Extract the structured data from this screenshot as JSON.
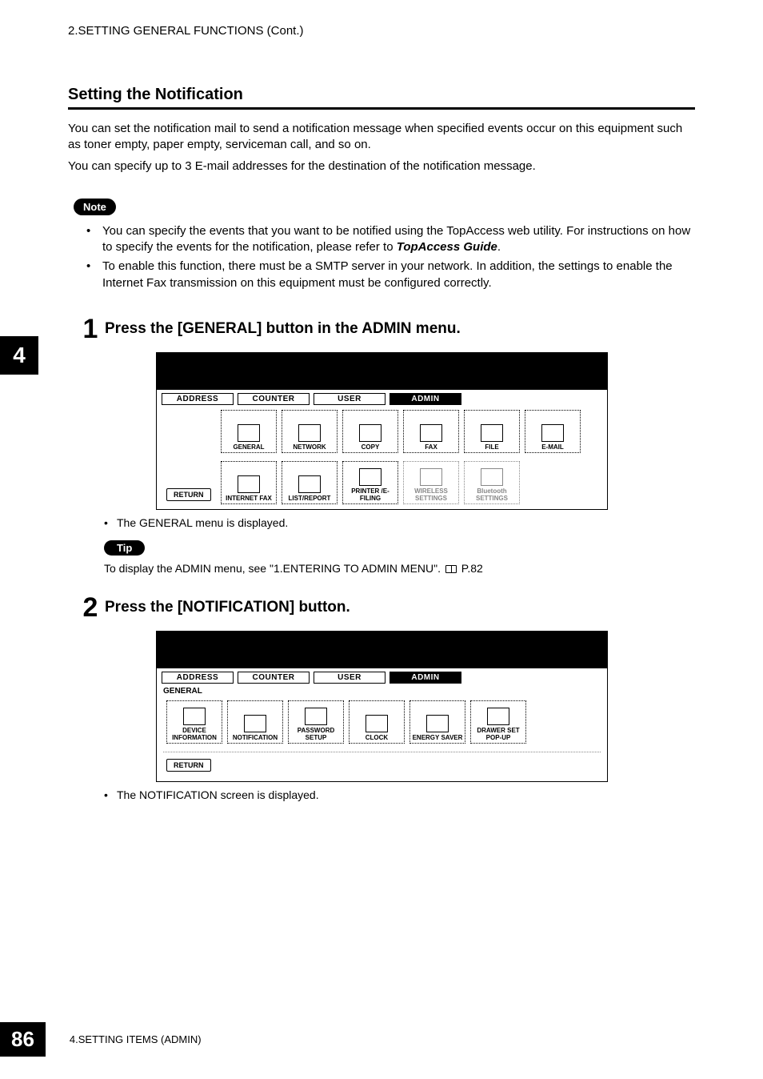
{
  "header": "2.SETTING GENERAL FUNCTIONS (Cont.)",
  "section_title": "Setting the Notification",
  "intro_p1": "You can set the notification mail to send a notification message when specified events occur on this equipment such as toner empty, paper empty, serviceman call, and so on.",
  "intro_p2": "You can specify up to 3 E-mail addresses for the destination of the notification message.",
  "note_label": "Note",
  "note_items": {
    "a_pre": "You can specify the events that you want to be notified using the TopAccess web utility.  For instructions on how to specify the events for the notification, please refer to ",
    "a_em": "TopAccess Guide",
    "a_post": ".",
    "b": "To enable this function, there must be a SMTP server in your network.  In addition, the settings to enable the Internet Fax transmission on this equipment must be configured correctly."
  },
  "side_tab": "4",
  "steps": {
    "s1": {
      "num": "1",
      "title": "Press the [GENERAL] button in the ADMIN menu.",
      "sub": "The GENERAL menu is displayed."
    },
    "s2": {
      "num": "2",
      "title": "Press the [NOTIFICATION] button.",
      "sub": "The NOTIFICATION screen is displayed."
    }
  },
  "tip_label": "Tip",
  "tip_text_pre": "To display the ADMIN menu, see \"1.ENTERING TO ADMIN MENU\".  ",
  "tip_text_ref": " P.82",
  "screen1": {
    "tabs": [
      "ADDRESS",
      "COUNTER",
      "USER",
      "ADMIN"
    ],
    "active_tab_index": 3,
    "row1": [
      "GENERAL",
      "NETWORK",
      "COPY",
      "FAX",
      "FILE",
      "E-MAIL"
    ],
    "row2": [
      "INTERNET FAX",
      "LIST/REPORT",
      "PRINTER /E-FILING",
      "WIRELESS SETTINGS",
      "Bluetooth SETTINGS"
    ],
    "return": "RETURN"
  },
  "screen2": {
    "tabs": [
      "ADDRESS",
      "COUNTER",
      "USER",
      "ADMIN"
    ],
    "active_tab_index": 3,
    "breadcrumb": "GENERAL",
    "row1": [
      "DEVICE INFORMATION",
      "NOTIFICATION",
      "PASSWORD SETUP",
      "CLOCK",
      "ENERGY SAVER",
      "DRAWER SET POP-UP"
    ],
    "return": "RETURN"
  },
  "footer": {
    "page": "86",
    "text": "4.SETTING ITEMS (ADMIN)"
  }
}
